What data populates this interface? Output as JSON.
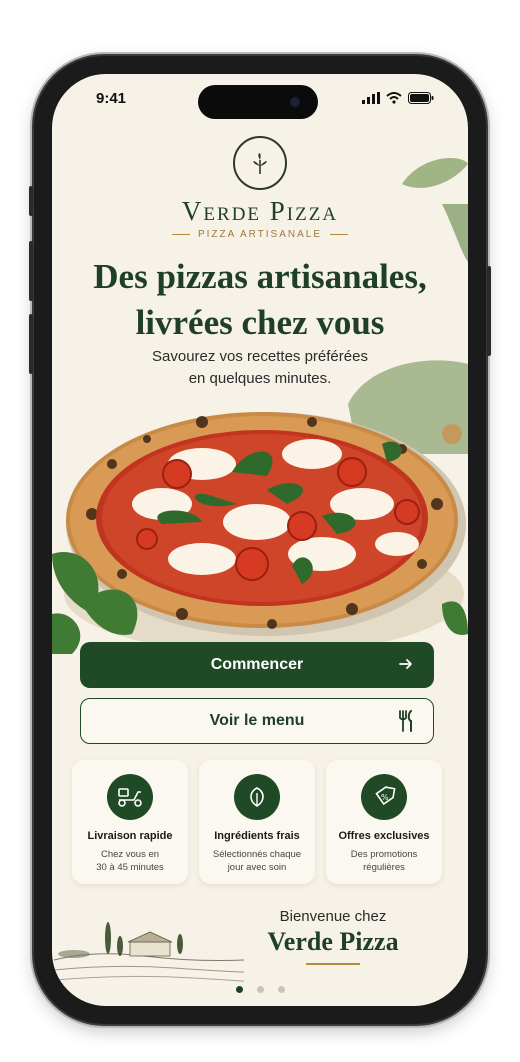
{
  "status_bar": {
    "time": "9:41"
  },
  "brand": {
    "name": "Verde Pizza",
    "tagline": "PIZZA ARTISANALE"
  },
  "hero": {
    "headline_line1": "Des pizzas artisanales,",
    "headline_line2": "livrées chez vous",
    "subtitle_line1": "Savourez vos recettes préférées",
    "subtitle_line2": "en quelques minutes."
  },
  "actions": {
    "primary_label": "Commencer",
    "secondary_label": "Voir le menu"
  },
  "features": [
    {
      "icon": "scooter-icon",
      "title": "Livraison rapide",
      "desc_line1": "Chez vous en",
      "desc_line2": "30 à 45 minutes"
    },
    {
      "icon": "leaf-icon",
      "title": "Ingrédients frais",
      "desc_line1": "Sélectionnés chaque",
      "desc_line2": "jour avec soin"
    },
    {
      "icon": "tag-percent-icon",
      "title": "Offres exclusives",
      "desc_line1": "Des promotions",
      "desc_line2": "régulières"
    }
  ],
  "welcome": {
    "line1": "Bienvenue chez",
    "line2": "Verde Pizza"
  },
  "pagination": {
    "current": 1,
    "total": 3
  },
  "colors": {
    "primary_green": "#1f4a25",
    "dark_green_text": "#1f3f26",
    "gold_accent": "#b48a3c",
    "cream_background": "#f7f2e8"
  }
}
